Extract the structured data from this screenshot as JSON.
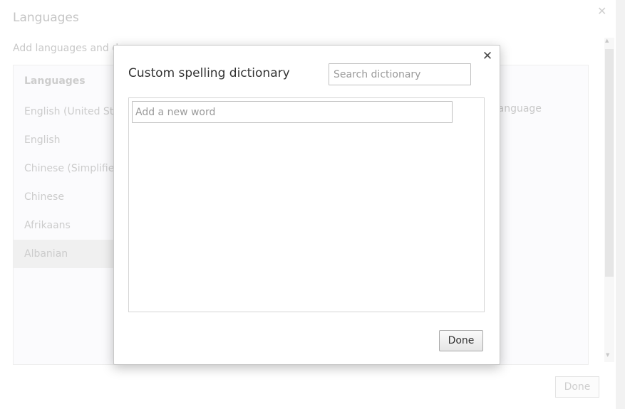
{
  "background": {
    "title": "Languages",
    "description": "Add languages and d",
    "list_header": "Languages",
    "languages": [
      {
        "label": "English (United Sta",
        "selected": false
      },
      {
        "label": "English",
        "selected": false
      },
      {
        "label": "Chinese (Simplified",
        "selected": false
      },
      {
        "label": "Chinese",
        "selected": false
      },
      {
        "label": "Afrikaans",
        "selected": false
      },
      {
        "label": "Albanian",
        "selected": true
      }
    ],
    "right_text": "s language",
    "close_glyph": "✕",
    "done_label": "Done"
  },
  "dialog": {
    "title": "Custom spelling dictionary",
    "close_glyph": "✕",
    "search_placeholder": "Search dictionary",
    "search_value": "",
    "new_word_placeholder": "Add a new word",
    "new_word_value": "",
    "words": [],
    "done_label": "Done"
  },
  "colors": {
    "dialog_border": "#c8c8c8",
    "button_border": "#a9a9a9",
    "dimmed_text": "#c3c3c3"
  }
}
